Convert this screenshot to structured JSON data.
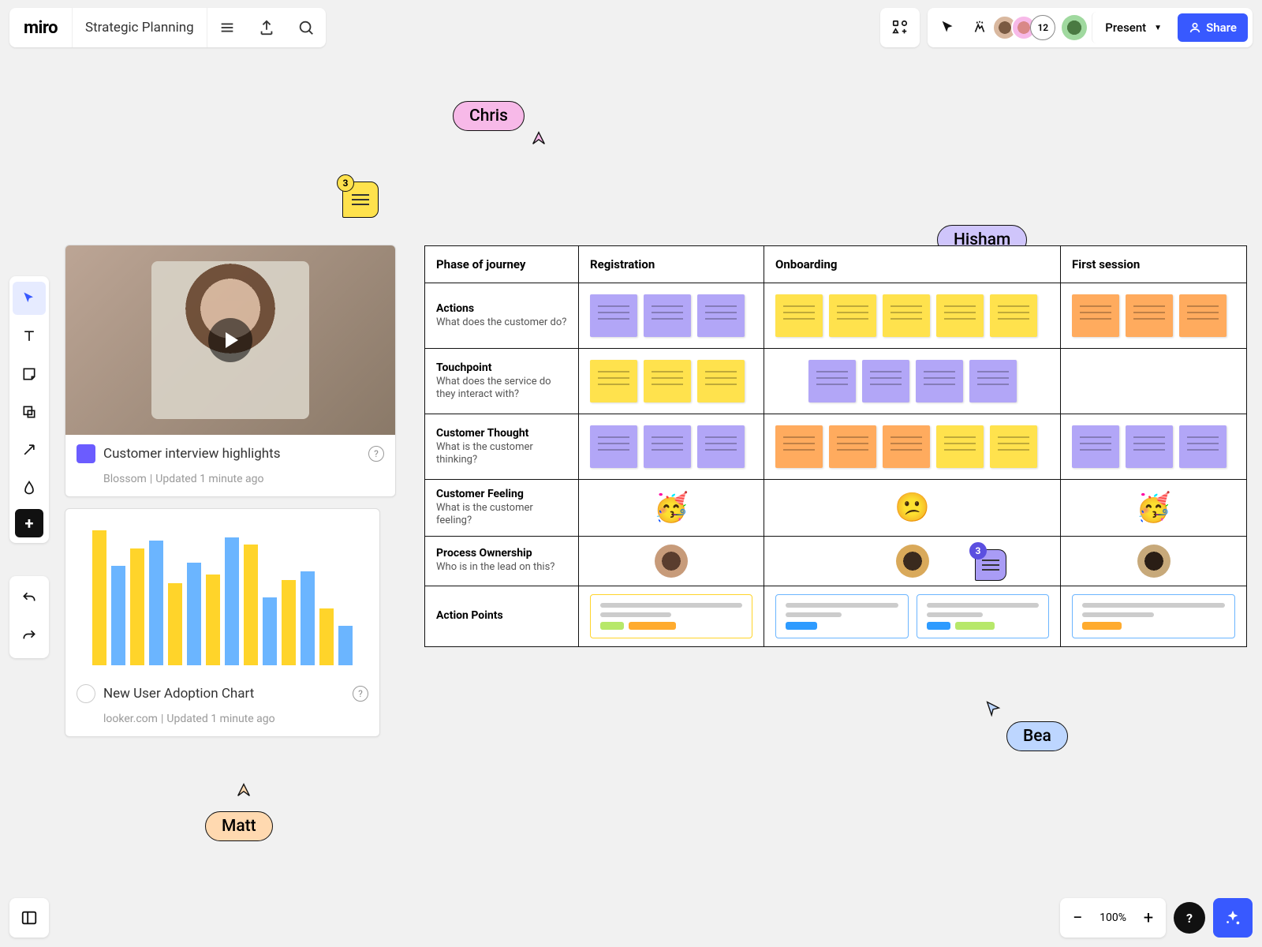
{
  "app": {
    "logo": "miro",
    "board_title": "Strategic Planning"
  },
  "topbar": {
    "avatar_count": "12",
    "present_label": "Present",
    "share_label": "Share"
  },
  "cursors": {
    "chris": "Chris",
    "hisham": "Hisham",
    "bea": "Bea",
    "matt": "Matt"
  },
  "comment_counts": {
    "yellow": "3",
    "purple": "3"
  },
  "embeds": {
    "video": {
      "title": "Customer interview highlights",
      "source": "Blossom",
      "updated": "Updated 1 minute ago"
    },
    "chart": {
      "title": "New User Adoption Chart",
      "source": "looker.com",
      "updated": "Updated 1 minute ago"
    }
  },
  "journey": {
    "header": {
      "phase": "Phase of journey",
      "reg": "Registration",
      "onb": "Onboarding",
      "first": "First session"
    },
    "rows": {
      "actions": {
        "title": "Actions",
        "sub": "What does the customer do?"
      },
      "touchpoint": {
        "title": "Touchpoint",
        "sub": "What does the service do they interact with?"
      },
      "thought": {
        "title": "Customer Thought",
        "sub": "What is the customer thinking?"
      },
      "feeling": {
        "title": "Customer Feeling",
        "sub": "What is the customer feeling?"
      },
      "ownership": {
        "title": "Process Ownership",
        "sub": "Who is in the lead on this?"
      },
      "action_points": {
        "title": "Action Points",
        "sub": ""
      }
    },
    "emojis": {
      "reg": "🥳",
      "onb": "😕",
      "first": "🥳"
    }
  },
  "zoom": {
    "level": "100%"
  },
  "chart_data": {
    "type": "bar",
    "title": "New User Adoption Chart",
    "series_colors": [
      "#ffd42a",
      "#6bb5ff"
    ],
    "bars": [
      {
        "color": "y",
        "h": 95
      },
      {
        "color": "b",
        "h": 70
      },
      {
        "color": "y",
        "h": 82
      },
      {
        "color": "b",
        "h": 88
      },
      {
        "color": "y",
        "h": 58
      },
      {
        "color": "b",
        "h": 72
      },
      {
        "color": "y",
        "h": 64
      },
      {
        "color": "b",
        "h": 90
      },
      {
        "color": "y",
        "h": 85
      },
      {
        "color": "b",
        "h": 48
      },
      {
        "color": "y",
        "h": 60
      },
      {
        "color": "b",
        "h": 66
      },
      {
        "color": "y",
        "h": 40
      },
      {
        "color": "b",
        "h": 28
      }
    ],
    "ylim": [
      0,
      100
    ]
  },
  "colors": {
    "chris": "#f7b9e8",
    "hisham": "#cfc5fb",
    "bea": "#bdd6ff",
    "matt": "#ffd9b0",
    "sticky_purple": "#b2a6f7",
    "sticky_yellow": "#ffe24d",
    "sticky_orange": "#ffab5e",
    "primary": "#3859ff"
  }
}
